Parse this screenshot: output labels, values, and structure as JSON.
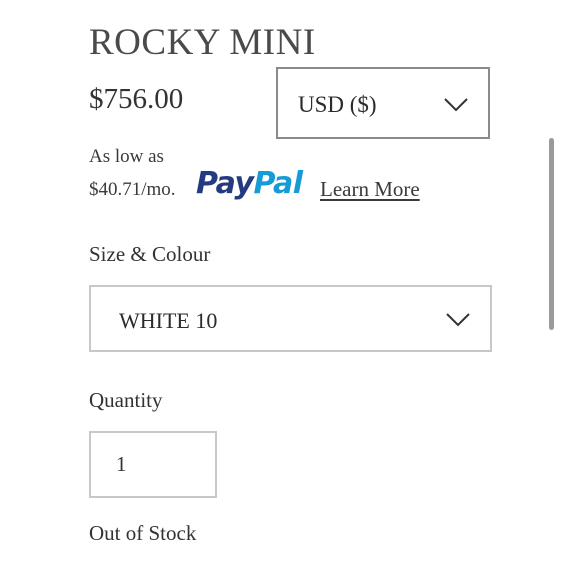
{
  "product": {
    "title": "ROCKY MINI",
    "price": "$756.00"
  },
  "currency_select": {
    "selected": "USD ($)"
  },
  "paypal": {
    "line1": "As low as",
    "line2": "$40.71/mo.",
    "logo_pay": "Pay",
    "logo_pal": "Pal",
    "learn_more": "Learn More",
    "colors": {
      "pay": "#253b80",
      "pal": "#179bd7"
    }
  },
  "variant": {
    "label": "Size & Colour",
    "selected": "WHITE 10"
  },
  "quantity": {
    "label": "Quantity",
    "value": "1"
  },
  "stock": {
    "status": "Out of Stock"
  },
  "icons": {
    "dropdown": "chevron-down-icon"
  }
}
